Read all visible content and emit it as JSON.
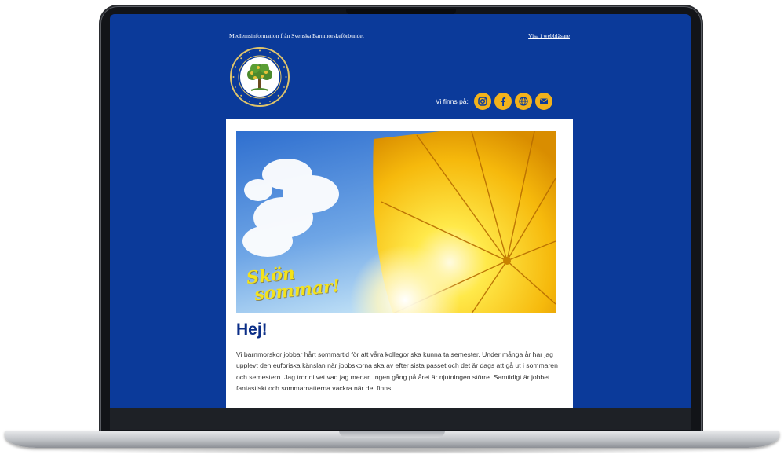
{
  "email": {
    "topbar": {
      "member_info": "Medlemsinformation från Svenska Barnmorskeförbundet",
      "view_in_browser": "Visa i webbläsare"
    },
    "social": {
      "label": "Vi finns på:",
      "icons": [
        "instagram-icon",
        "facebook-icon",
        "web-icon",
        "mail-icon"
      ],
      "icon_color": "#f2b21b"
    },
    "hero": {
      "line1": "Skön",
      "line2": "sommar!"
    },
    "greeting": "Hej!",
    "body": "Vi barnmorskor jobbar hårt sommartid för att våra kollegor ska kunna ta semester. Under många år har jag upplevt den euforiska känslan när jobbskorna ska av efter sista passet och det är dags att gå ut i sommaren och semestern. Jag tror ni vet vad jag menar. Ingen gång på året är njutningen större. Samtidigt är jobbet fantastiskt och sommarnatterna vackra när det finns"
  },
  "colors": {
    "background": "#0b3a9a",
    "heading": "#0b2e87",
    "accent": "#f2b21b"
  }
}
